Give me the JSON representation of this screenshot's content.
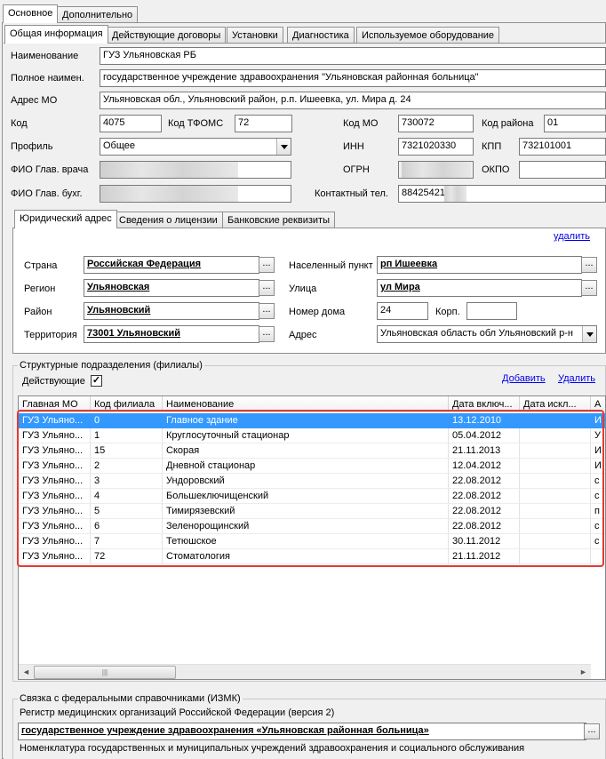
{
  "top_tabs": [
    "Основное",
    "Дополнительно"
  ],
  "sub_tabs": [
    "Общая информация",
    "Действующие договоры",
    "Установки",
    "Диагностика",
    "Используемое оборудование"
  ],
  "labels": {
    "name": "Наименование",
    "fullname": "Полное наимен.",
    "address": "Адрес МО",
    "code": "Код",
    "tfoms": "Код ТФОМС",
    "code_mo": "Код МО",
    "district_code": "Код района",
    "profile": "Профиль",
    "inn": "ИНН",
    "kpp": "КПП",
    "chief_doctor": "ФИО Глав. врача",
    "ogrn": "ОГРН",
    "okpo": "ОКПО",
    "chief_accountant": "ФИО Глав. бухг.",
    "phone": "Контактный тел."
  },
  "values": {
    "name": "ГУЗ Ульяновская РБ",
    "fullname": "государственное учреждение здравоохранения \"Ульяновская районная больница\"",
    "address": "Ульяновская обл., Ульяновский район, р.п. Ишеевка, ул. Мира д. 24",
    "code": "4075",
    "tfoms": "72",
    "code_mo": "730072",
    "district_code": "01",
    "profile": "Общее",
    "inn": "7321020330",
    "kpp": "732101001",
    "phone": "88425421"
  },
  "addr_tabs": [
    "Юридический адрес",
    "Сведения о лицензии",
    "Банковские реквизиты"
  ],
  "addr": {
    "delete_link": "удалить",
    "country_label": "Страна",
    "country": "Российская Федерация",
    "region_label": "Регион",
    "region": "Ульяновская",
    "district_label": "Район",
    "district": "Ульяновский",
    "territory_label": "Территория",
    "territory": "73001 Ульяновский",
    "locality_label": "Населенный пункт",
    "locality": "рп Ишеевка",
    "street_label": "Улица",
    "street": "ул Мира",
    "house_label": "Номер дома",
    "house": "24",
    "corp_label": "Корп.",
    "address_label": "Адрес",
    "address": "Ульяновская область обл Ульяновский р-н"
  },
  "branches": {
    "title": "Структурные подразделения (филиалы)",
    "active_label": "Действующие",
    "active_mark": "✓",
    "add_link": "Добавить",
    "delete_link": "Удалить",
    "columns": [
      "Главная МО",
      "Код филиала",
      "Наименование",
      "Дата включ...",
      "Дата искл...",
      "А"
    ],
    "rows": [
      [
        "ГУЗ Ульяно...",
        "0",
        "Главное здание",
        "13.12.2010",
        "",
        "И"
      ],
      [
        "ГУЗ Ульяно...",
        "1",
        "Круглосуточный стационар",
        "05.04.2012",
        "",
        "У"
      ],
      [
        "ГУЗ Ульяно...",
        "15",
        "Скорая",
        "21.11.2013",
        "",
        "И"
      ],
      [
        "ГУЗ Ульяно...",
        "2",
        "Дневной стационар",
        "12.04.2012",
        "",
        "И"
      ],
      [
        "ГУЗ Ульяно...",
        "3",
        "Ундоровский",
        "22.08.2012",
        "",
        "с"
      ],
      [
        "ГУЗ Ульяно...",
        "4",
        "Большеключищенский",
        "22.08.2012",
        "",
        "с"
      ],
      [
        "ГУЗ Ульяно...",
        "5",
        "Тимирязевский",
        "22.08.2012",
        "",
        "п"
      ],
      [
        "ГУЗ Ульяно...",
        "6",
        "Зеленорощинский",
        "22.08.2012",
        "",
        "с"
      ],
      [
        "ГУЗ Ульяно...",
        "7",
        "Тетюшское",
        "30.11.2012",
        "",
        "с"
      ],
      [
        "ГУЗ Ульяно...",
        "72",
        "Стоматология",
        "21.11.2012",
        "",
        ""
      ]
    ],
    "scroll_left": "◄",
    "scroll_right": "►",
    "scroll_thumb": "|||"
  },
  "izmk": {
    "title": "Связка с федеральными справочниками (ИЗМК)",
    "registry_label": "Регистр медицинских организаций Российской Федерации (версия 2)",
    "registry_value": "государственное учреждение здравоохранения «Ульяновская районная больница»",
    "nomenclature_label": "Номенклатура государственных и муниципальных учреждений здравоохранения и социального обслуживания"
  },
  "dots": "...",
  "highlight_color": "#e53935"
}
